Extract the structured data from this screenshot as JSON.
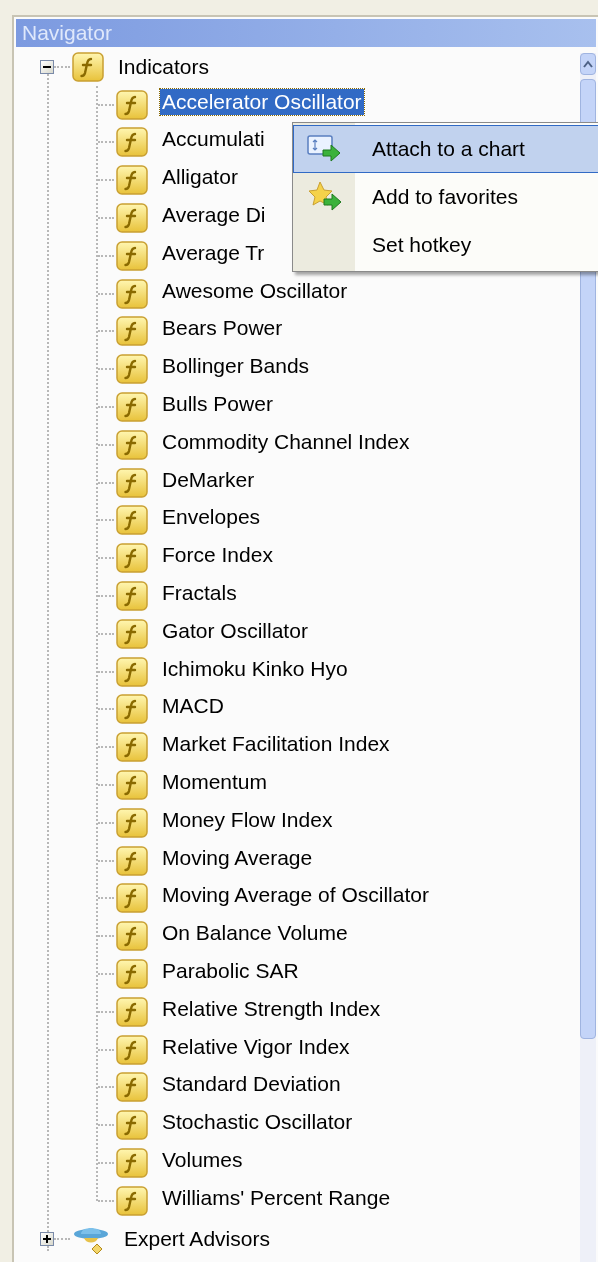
{
  "window": {
    "title": "Navigator"
  },
  "tree": [
    {
      "label": "Indicators",
      "kind": "indicator",
      "expanded": true,
      "selected": false,
      "children": [
        {
          "label": "Accelerator Oscillator",
          "selected": true
        },
        {
          "label": "Accumulati",
          "selected": false
        },
        {
          "label": "Alligator",
          "selected": false
        },
        {
          "label": "Average Di",
          "selected": false
        },
        {
          "label": "Average Tr",
          "selected": false
        },
        {
          "label": "Awesome Oscillator",
          "selected": false
        },
        {
          "label": "Bears Power",
          "selected": false
        },
        {
          "label": "Bollinger Bands",
          "selected": false
        },
        {
          "label": "Bulls Power",
          "selected": false
        },
        {
          "label": "Commodity Channel Index",
          "selected": false
        },
        {
          "label": "DeMarker",
          "selected": false
        },
        {
          "label": "Envelopes",
          "selected": false
        },
        {
          "label": "Force Index",
          "selected": false
        },
        {
          "label": "Fractals",
          "selected": false
        },
        {
          "label": "Gator Oscillator",
          "selected": false
        },
        {
          "label": "Ichimoku Kinko Hyo",
          "selected": false
        },
        {
          "label": "MACD",
          "selected": false
        },
        {
          "label": "Market Facilitation Index",
          "selected": false
        },
        {
          "label": "Momentum",
          "selected": false
        },
        {
          "label": "Money Flow Index",
          "selected": false
        },
        {
          "label": "Moving Average",
          "selected": false
        },
        {
          "label": "Moving Average of Oscillator",
          "selected": false
        },
        {
          "label": "On Balance Volume",
          "selected": false
        },
        {
          "label": "Parabolic SAR",
          "selected": false
        },
        {
          "label": "Relative Strength Index",
          "selected": false
        },
        {
          "label": "Relative Vigor Index",
          "selected": false
        },
        {
          "label": "Standard Deviation",
          "selected": false
        },
        {
          "label": "Stochastic Oscillator",
          "selected": false
        },
        {
          "label": "Volumes",
          "selected": false
        },
        {
          "label": "Williams' Percent Range",
          "selected": false
        }
      ]
    },
    {
      "label": "Expert Advisors",
      "kind": "expert",
      "expanded": false,
      "selected": false
    }
  ],
  "context_menu": [
    {
      "label": "Attach to a chart",
      "kind": "attach",
      "selected": true
    },
    {
      "label": "Add to favorites",
      "kind": "favorite",
      "selected": false
    },
    {
      "label": "Set hotkey",
      "kind": "plain",
      "selected": false
    }
  ]
}
